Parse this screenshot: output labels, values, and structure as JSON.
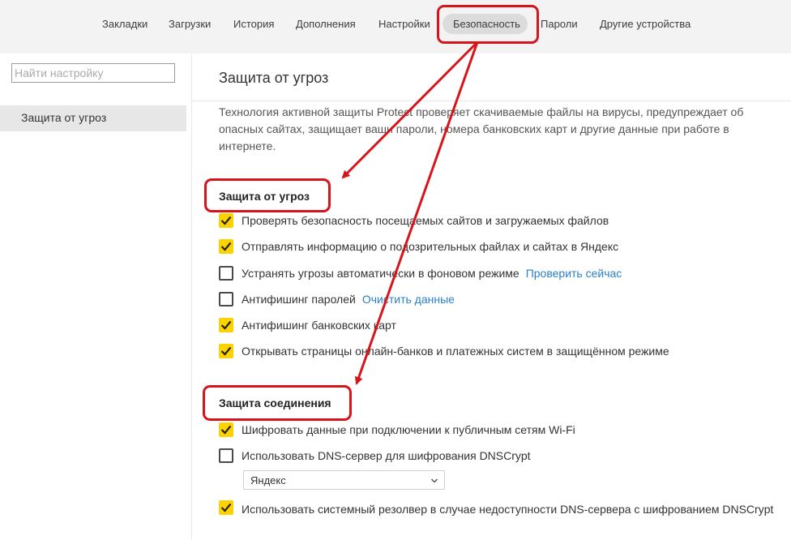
{
  "nav": {
    "tabs": [
      {
        "label": "Закладки"
      },
      {
        "label": "Загрузки"
      },
      {
        "label": "История"
      },
      {
        "label": "Дополнения"
      },
      {
        "label": "Настройки"
      },
      {
        "label": "Безопасность",
        "active": true
      },
      {
        "label": "Пароли"
      },
      {
        "label": "Другие устройства"
      }
    ]
  },
  "sidebar": {
    "search_placeholder": "Найти настройку",
    "items": [
      {
        "label": "Защита от угроз",
        "selected": true
      }
    ]
  },
  "main": {
    "title": "Защита от угроз",
    "description": "Технология активной защиты Protect проверяет скачиваемые файлы на вирусы, предупреждает об опасных сайтах, защищает ваши пароли, номера банковских карт и другие данные при работе в интернете.",
    "sections": [
      {
        "title": "Защита от угроз",
        "options": [
          {
            "label": "Проверять безопасность посещаемых сайтов и загружаемых файлов",
            "checked": true
          },
          {
            "label": "Отправлять информацию о подозрительных файлах и сайтах в Яндекс",
            "checked": true
          },
          {
            "label": "Устранять угрозы автоматически в фоновом режиме",
            "checked": false,
            "link": "Проверить сейчас"
          },
          {
            "label": "Антифишинг паролей",
            "checked": false,
            "link": "Очистить данные"
          },
          {
            "label": "Антифишинг банковских карт",
            "checked": true
          },
          {
            "label": "Открывать страницы онлайн-банков и платежных систем в защищённом режиме",
            "checked": true
          }
        ]
      },
      {
        "title": "Защита соединения",
        "options": [
          {
            "label": "Шифровать данные при подключении к публичным сетям Wi-Fi",
            "checked": true
          },
          {
            "label": "Использовать DNS-сервер для шифрования DNSCrypt",
            "checked": false
          },
          {
            "label": "Использовать системный резолвер в случае недоступности DNS-сервера с шифрованием DNSCrypt",
            "checked": true
          }
        ],
        "dns_select": {
          "value": "Яндекс"
        }
      }
    ]
  },
  "colors": {
    "checkbox_checked": "#fcd201",
    "link": "#2a7fc5",
    "annotation": "#d8141b"
  }
}
